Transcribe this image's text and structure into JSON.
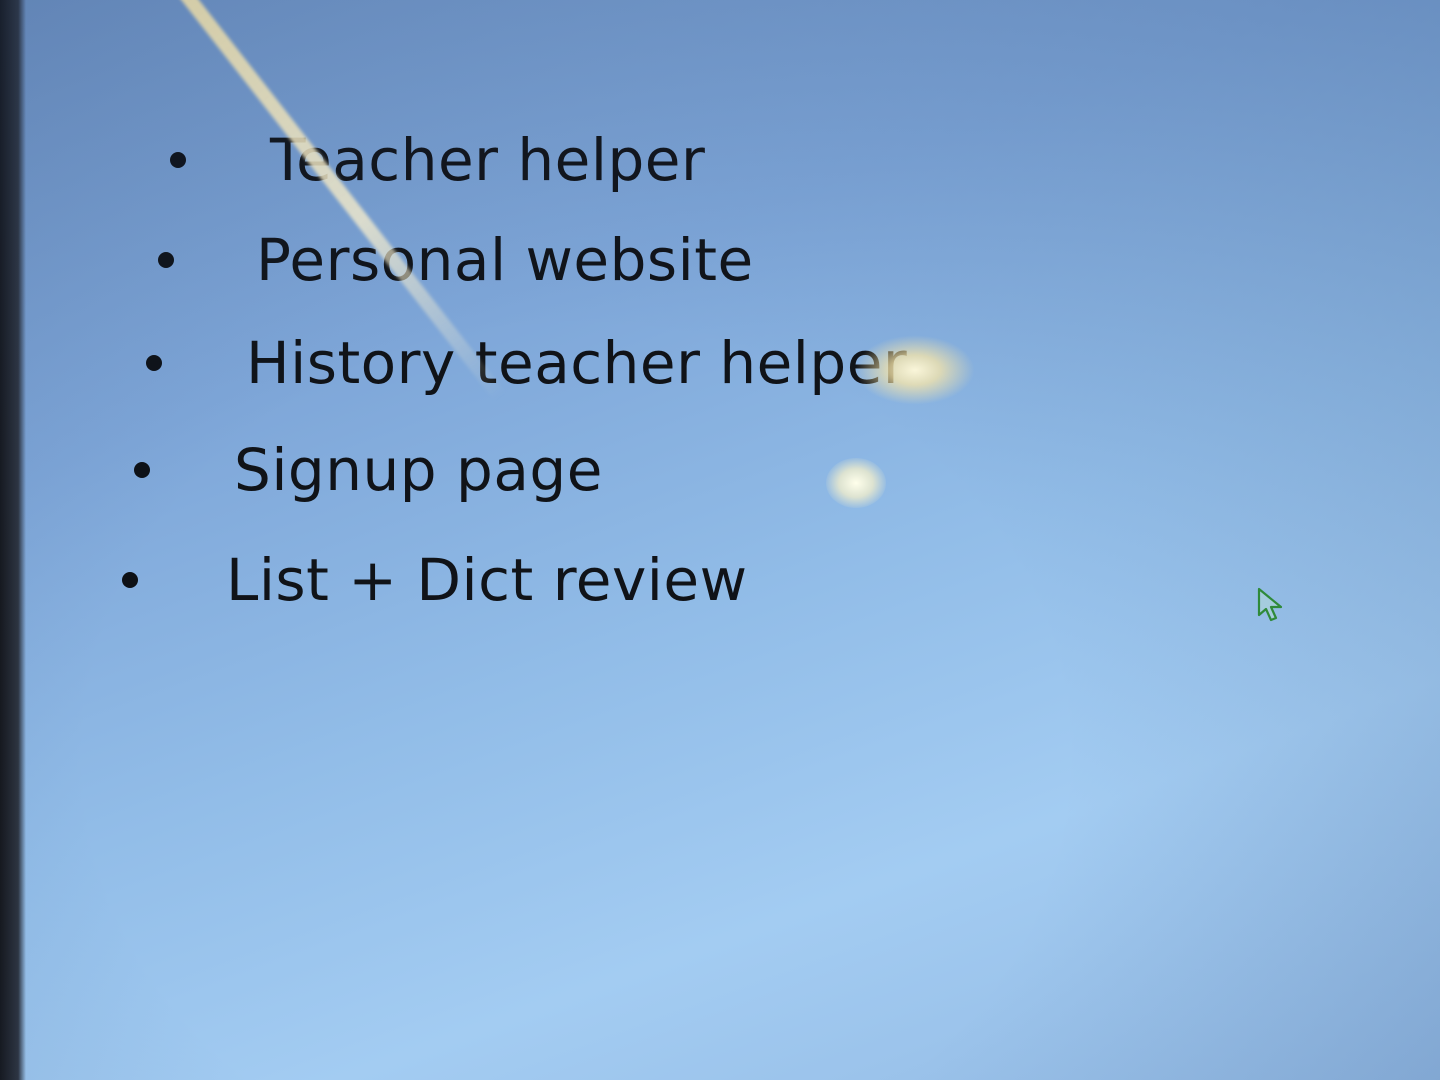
{
  "slide": {
    "bullets": [
      {
        "text": "Teacher helper"
      },
      {
        "text": "Personal website"
      },
      {
        "text": "History teacher helper"
      },
      {
        "text": "Signup page"
      },
      {
        "text": "List + Dict review"
      }
    ]
  },
  "cursor": {
    "icon": "arrow-cursor-icon",
    "color": "#2f8a3a"
  },
  "colors": {
    "text": "#101318",
    "background": "#92bde8"
  }
}
